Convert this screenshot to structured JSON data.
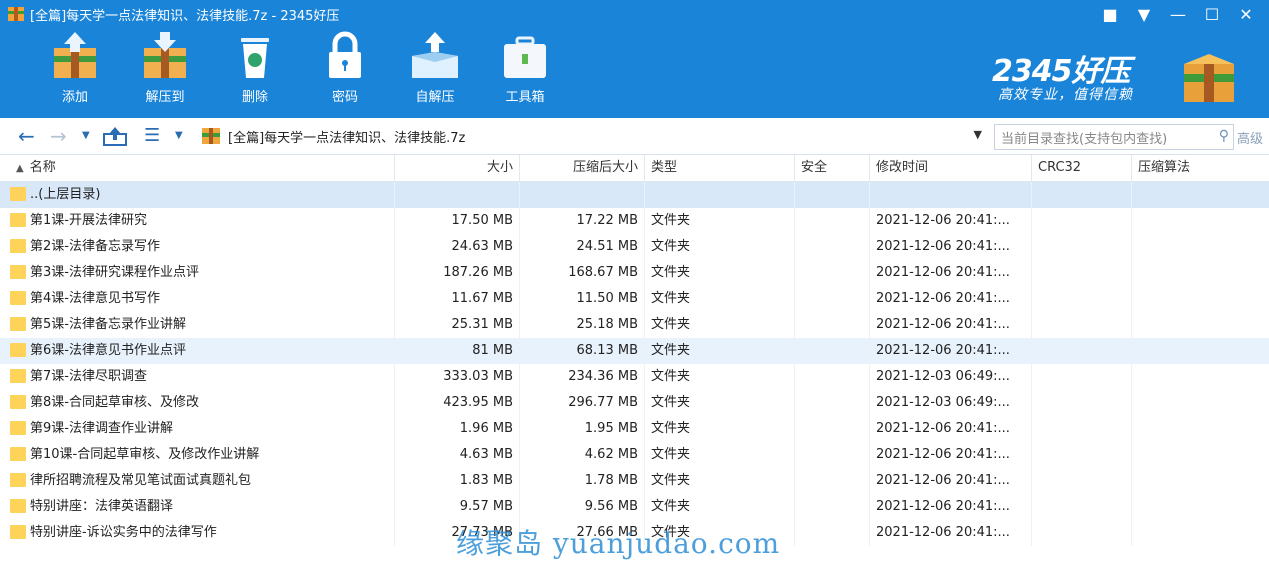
{
  "window": {
    "title": "[全篇]每天学一点法律知识、法律技能.7z - 2345好压",
    "controls": [
      "chat-icon",
      "menu-dropdown-icon",
      "minimize-icon",
      "maximize-icon",
      "close-icon"
    ]
  },
  "toolbar": {
    "items": [
      {
        "label": "添加",
        "icon": "add-archive-icon"
      },
      {
        "label": "解压到",
        "icon": "extract-to-icon"
      },
      {
        "label": "删除",
        "icon": "delete-icon"
      },
      {
        "label": "密码",
        "icon": "password-icon"
      },
      {
        "label": "自解压",
        "icon": "self-extract-icon"
      },
      {
        "label": "工具箱",
        "icon": "toolbox-icon"
      }
    ]
  },
  "brand": {
    "name": "2345好压",
    "slogan": "高效专业，值得信赖"
  },
  "address": {
    "path": "[全篇]每天学一点法律知识、法律技能.7z",
    "search_placeholder": "当前目录查找(支持包内查找)",
    "advanced": "高级"
  },
  "columns": {
    "name": "名称",
    "size": "大小",
    "csize": "压缩后大小",
    "type": "类型",
    "security": "安全",
    "time": "修改时间",
    "crc": "CRC32",
    "algo": "压缩算法"
  },
  "parent_row": "..(上层目录)",
  "rows": [
    {
      "name": "第1课-开展法律研究",
      "size": "17.50 MB",
      "csize": "17.22 MB",
      "type": "文件夹",
      "time": "2021-12-06 20:41:..."
    },
    {
      "name": "第2课-法律备忘录写作",
      "size": "24.63 MB",
      "csize": "24.51 MB",
      "type": "文件夹",
      "time": "2021-12-06 20:41:..."
    },
    {
      "name": "第3课-法律研究课程作业点评",
      "size": "187.26 MB",
      "csize": "168.67 MB",
      "type": "文件夹",
      "time": "2021-12-06 20:41:..."
    },
    {
      "name": "第4课-法律意见书写作",
      "size": "11.67 MB",
      "csize": "11.50 MB",
      "type": "文件夹",
      "time": "2021-12-06 20:41:..."
    },
    {
      "name": "第5课-法律备忘录作业讲解",
      "size": "25.31 MB",
      "csize": "25.18 MB",
      "type": "文件夹",
      "time": "2021-12-06 20:41:..."
    },
    {
      "name": "第6课-法律意见书作业点评",
      "size": "81 MB",
      "csize": "68.13 MB",
      "type": "文件夹",
      "time": "2021-12-06 20:41:..."
    },
    {
      "name": "第7课-法律尽职调查",
      "size": "333.03 MB",
      "csize": "234.36 MB",
      "type": "文件夹",
      "time": "2021-12-03 06:49:..."
    },
    {
      "name": "第8课-合同起草审核、及修改",
      "size": "423.95 MB",
      "csize": "296.77 MB",
      "type": "文件夹",
      "time": "2021-12-03 06:49:..."
    },
    {
      "name": "第9课-法律调查作业讲解",
      "size": "1.96 MB",
      "csize": "1.95 MB",
      "type": "文件夹",
      "time": "2021-12-06 20:41:..."
    },
    {
      "name": "第10课-合同起草审核、及修改作业讲解",
      "size": "4.63 MB",
      "csize": "4.62 MB",
      "type": "文件夹",
      "time": "2021-12-06 20:41:..."
    },
    {
      "name": "律所招聘流程及常见笔试面试真题礼包",
      "size": "1.83 MB",
      "csize": "1.78 MB",
      "type": "文件夹",
      "time": "2021-12-06 20:41:..."
    },
    {
      "name": "特别讲座：法律英语翻译",
      "size": "9.57 MB",
      "csize": "9.56 MB",
      "type": "文件夹",
      "time": "2021-12-06 20:41:..."
    },
    {
      "name": "特别讲座-诉讼实务中的法律写作",
      "size": "27.73 MB",
      "csize": "27.66 MB",
      "type": "文件夹",
      "time": "2021-12-06 20:41:..."
    }
  ],
  "watermark": "缘聚岛 yuanjudao.com"
}
